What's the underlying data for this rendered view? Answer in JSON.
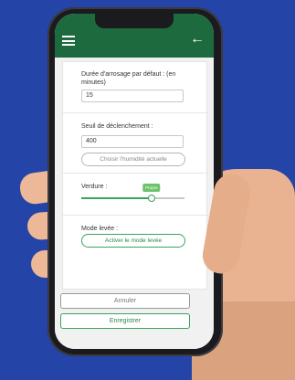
{
  "settings": {
    "duration": {
      "label": "Durée d'arrosage par défaut : (en minutes)",
      "value": "15"
    },
    "threshold": {
      "label": "Seuil de déclenchement :",
      "value": "400",
      "button": "Choisir l'humidité actuelle"
    },
    "greenery": {
      "label": "Verdure :",
      "slider_value_label": "Propre",
      "slider_level": 0.68
    },
    "mode": {
      "label": "Mode levée :",
      "button": "Activer le mode levée"
    }
  },
  "actions": {
    "cancel": "Annuler",
    "save": "Enregistrer"
  },
  "icons": {
    "menu": "menu-icon",
    "back": "arrow-left-icon"
  },
  "colors": {
    "appbar": "#1d6a3f",
    "accent": "#3aa35d",
    "background": "#2444a8"
  }
}
